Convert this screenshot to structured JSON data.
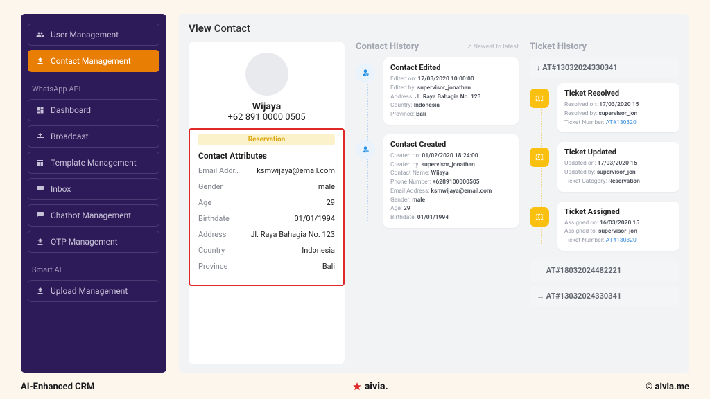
{
  "sidebar": {
    "groups": [
      {
        "items": [
          {
            "label": "User Management"
          },
          {
            "label": "Contact Management",
            "active": true
          }
        ]
      },
      {
        "heading": "WhatsApp API",
        "items": [
          {
            "label": "Dashboard"
          },
          {
            "label": "Broadcast"
          },
          {
            "label": "Template Management"
          },
          {
            "label": "Inbox"
          },
          {
            "label": "Chatbot Management"
          },
          {
            "label": "OTP Management"
          }
        ]
      },
      {
        "heading": "Smart AI",
        "items": [
          {
            "label": "Upload Management"
          }
        ]
      }
    ]
  },
  "page": {
    "title_bold": "View",
    "title_rest": "Contact"
  },
  "contact": {
    "name": "Wijaya",
    "phone": "+62 891 0000 0505",
    "badge": "Reservation",
    "attr_heading": "Contact Attributes",
    "attributes": [
      {
        "label": "Email Addr…",
        "value": "ksmwijaya@email.com"
      },
      {
        "label": "Gender",
        "value": "male"
      },
      {
        "label": "Age",
        "value": "29"
      },
      {
        "label": "Birthdate",
        "value": "01/01/1994"
      },
      {
        "label": "Address",
        "value": "Jl. Raya Bahagia No. 123"
      },
      {
        "label": "Country",
        "value": "Indonesia"
      },
      {
        "label": "Province",
        "value": "Bali"
      }
    ]
  },
  "contact_history": {
    "heading": "Contact History",
    "sort_label": "↗ Newest to latest",
    "items": [
      {
        "title": "Contact Edited",
        "lines": [
          {
            "k": "Edited on:",
            "v": "17/03/2020 10:00:00"
          },
          {
            "k": "Edited by:",
            "v": "supervisor_jonathan"
          },
          {
            "k": "Address:",
            "v": "Jl. Raya Bahagia No. 123"
          },
          {
            "k": "Country:",
            "v": "Indonesia"
          },
          {
            "k": "Province:",
            "v": "Bali"
          }
        ]
      },
      {
        "title": "Contact Created",
        "lines": [
          {
            "k": "Created on:",
            "v": "01/02/2020 18:24:00"
          },
          {
            "k": "Created by:",
            "v": "supervisor_jonathan"
          },
          {
            "k": "Contact Name:",
            "v": "Wijaya"
          },
          {
            "k": "Phone Number:",
            "v": "+6289100000505"
          },
          {
            "k": "Email Address:",
            "v": "ksmwijaya@email.com"
          },
          {
            "k": "Gender:",
            "v": "male"
          },
          {
            "k": "Age:",
            "v": "29"
          },
          {
            "k": "Birthdate:",
            "v": "01/01/1994"
          }
        ]
      }
    ]
  },
  "ticket_history": {
    "heading": "Ticket History",
    "top_ref": "↓ AT#13032024330341",
    "items": [
      {
        "title": "Ticket Resolved",
        "lines": [
          {
            "k": "Resolved on:",
            "v": "17/03/2020 15"
          },
          {
            "k": "Resolved by:",
            "v": "supervisor_jon"
          },
          {
            "k": "Ticket Number:",
            "v": "AT#130320",
            "link": true
          }
        ]
      },
      {
        "title": "Ticket Updated",
        "lines": [
          {
            "k": "Updated on:",
            "v": "17/03/2020 16"
          },
          {
            "k": "Updated by:",
            "v": "supervisor_jon"
          },
          {
            "k": "Ticket Category:",
            "v": "Reservation"
          }
        ]
      },
      {
        "title": "Ticket Assigned",
        "lines": [
          {
            "k": "Assigned on:",
            "v": "16/03/2020 15"
          },
          {
            "k": "Assigned to:",
            "v": "supervisor_jon"
          },
          {
            "k": "Ticket Number:",
            "v": "AT#130320",
            "link": true
          }
        ]
      }
    ],
    "bottom_refs": [
      "→ AT#18032024482221",
      "→ AT#13032024330341"
    ]
  },
  "footer": {
    "left": "AI-Enhanced CRM",
    "center": "aivia.",
    "right": "© aivia.me"
  }
}
